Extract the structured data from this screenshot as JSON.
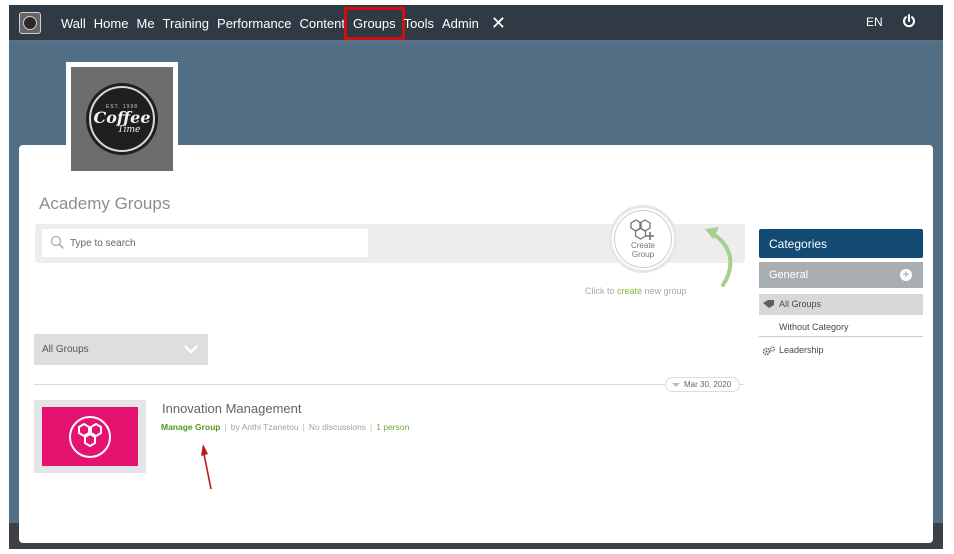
{
  "nav": {
    "items": [
      "Wall",
      "Home",
      "Me",
      "Training",
      "Performance",
      "Content",
      "Groups",
      "Tools",
      "Admin"
    ],
    "highlighted": "Groups",
    "lang": "EN",
    "icons": [
      "app-logo-icon",
      "close-x-icon",
      "power-icon"
    ]
  },
  "logo": {
    "top": "EST. 1998",
    "main": "Coffee",
    "sub": "Time"
  },
  "page": {
    "title": "Academy Groups"
  },
  "search": {
    "placeholder": "Type to search"
  },
  "create": {
    "label_line1": "Create",
    "label_line2": "Group",
    "hint_pre": "Click to",
    "hint_link": "create",
    "hint_post": "new group"
  },
  "filter": {
    "selected": "All Groups"
  },
  "groups": [
    {
      "date": "Mar 30, 2020",
      "name": "Innovation Management",
      "manage_label": "Manage Group",
      "author": "by Anthi Tzanetou",
      "discussions": "No discussions",
      "members": "1 person"
    }
  ],
  "sidebar": {
    "header": "Categories",
    "general": "General",
    "items": [
      "All Groups",
      "Without Category",
      "Leadership"
    ]
  },
  "colors": {
    "nav_bg": "#2f3a44",
    "page_bg": "#536f86",
    "accent_blue": "#124a73",
    "accent_green": "#6aab2e",
    "group_pink": "#e5126f",
    "highlight_red": "#d10f0f"
  }
}
